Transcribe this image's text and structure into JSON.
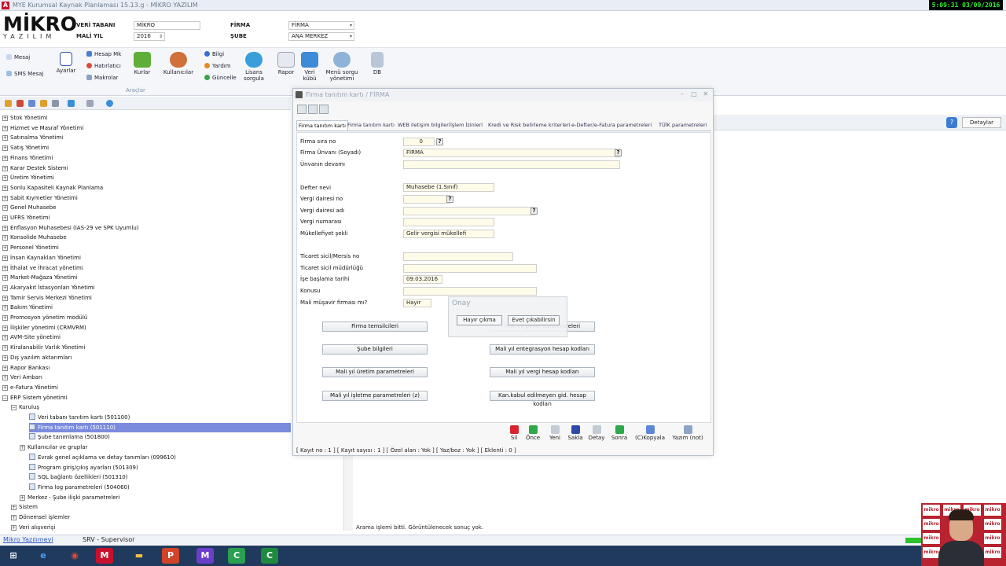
{
  "window": {
    "title": "MYE Kurumsal Kaynak Planlaması 15.13.g - MİKRO YAZILIM",
    "app_icon": "A",
    "clock": "5:09:31  03/09/2016"
  },
  "header": {
    "logo_main": "MİKRO",
    "logo_sub": "YAZILIM",
    "veri_tabani_label": "VERİ TABANI",
    "veri_tabani_value": "MİKRO",
    "mali_yil_label": "MALİ YIL",
    "mali_yil_value": "2016",
    "firma_label": "FİRMA",
    "firma_value": "FİRMA",
    "sube_label": "ŞUBE",
    "sube_value": "ANA MERKEZ"
  },
  "ribbon": {
    "mesaj": "Mesaj",
    "sms_mesaj": "SMS Mesaj",
    "ayarlar": "Ayarlar",
    "hesap_mk": "Hesap Mk",
    "hatirlatici": "Hatırlatıcı",
    "makrolar": "Makrolar",
    "kurlar": "Kurlar",
    "kullanicilar": "Kullanıcılar",
    "bilgi": "Bilgi",
    "yardim": "Yardım",
    "guncelle": "Güncelle",
    "lisans_sorgula": "Lisans sorgula",
    "rapor": "Rapor",
    "veri_kubu": "Veri kübü",
    "menu_sorgu_yonetimi": "Menü sorgu yönetimi",
    "db": "DB",
    "group_araclar": "Araçlar"
  },
  "tree": {
    "items": [
      {
        "label": "Stok Yönetimi",
        "level": 0,
        "expanded": false
      },
      {
        "label": "Hizmet ve Masraf Yönetimi",
        "level": 0,
        "expanded": false
      },
      {
        "label": "Satınalma Yönetimi",
        "level": 0,
        "expanded": false
      },
      {
        "label": "Satış Yönetimi",
        "level": 0,
        "expanded": false
      },
      {
        "label": "Finans Yönetimi",
        "level": 0,
        "expanded": false
      },
      {
        "label": "Karar Destek Sistemi",
        "level": 0,
        "expanded": false
      },
      {
        "label": "Üretim Yönetimi",
        "level": 0,
        "expanded": false
      },
      {
        "label": "Sonlu Kapasiteli Kaynak Planlama",
        "level": 0,
        "expanded": false
      },
      {
        "label": "Sabit Kıymetler Yönetimi",
        "level": 0,
        "expanded": false
      },
      {
        "label": "Genel Muhasebe",
        "level": 0,
        "expanded": false
      },
      {
        "label": "UFRS Yönetimi",
        "level": 0,
        "expanded": false
      },
      {
        "label": "Enflasyon Muhasebesi (IAS-29 ve SPK Uyumlu)",
        "level": 0,
        "expanded": false
      },
      {
        "label": "Konsolide Muhasebe",
        "level": 0,
        "expanded": false
      },
      {
        "label": "Personel Yönetimi",
        "level": 0,
        "expanded": false
      },
      {
        "label": "İnsan Kaynakları Yönetimi",
        "level": 0,
        "expanded": false
      },
      {
        "label": "İthalat ve İhracat yönetimi",
        "level": 0,
        "expanded": false
      },
      {
        "label": "Market-Mağaza Yönetimi",
        "level": 0,
        "expanded": false
      },
      {
        "label": "Akaryakıt İstasyonları Yönetimi",
        "level": 0,
        "expanded": false
      },
      {
        "label": "Tamir Servis Merkezi Yönetimi",
        "level": 0,
        "expanded": false
      },
      {
        "label": "Bakım Yönetimi",
        "level": 0,
        "expanded": false
      },
      {
        "label": "Promosyon yönetim modülü",
        "level": 0,
        "expanded": false
      },
      {
        "label": "İlişkiler yönetimi (CRMVRM)",
        "level": 0,
        "expanded": false
      },
      {
        "label": "AVM-Site yönetimi",
        "level": 0,
        "expanded": false
      },
      {
        "label": "Kiralanabilir Varlık Yönetimi",
        "level": 0,
        "expanded": false
      },
      {
        "label": "Dış yazılım aktarımları",
        "level": 0,
        "expanded": false
      },
      {
        "label": "Rapor Bankası",
        "level": 0,
        "expanded": false
      },
      {
        "label": "Veri Ambarı",
        "level": 0,
        "expanded": false
      },
      {
        "label": "e-Fatura Yönetimi",
        "level": 0,
        "expanded": false
      },
      {
        "label": "ERP Sistem yönetimi",
        "level": 0,
        "expanded": true
      },
      {
        "label": "Kuruluş",
        "level": 1,
        "expanded": true
      },
      {
        "label": "Veri tabanı tanıtım kartı (501100)",
        "level": 2,
        "leaf": true
      },
      {
        "label": "Firma tanıtım kartı (501110)",
        "level": 2,
        "leaf": true,
        "selected": true
      },
      {
        "label": "Şube tanımlama (501800)",
        "level": 2,
        "leaf": true
      },
      {
        "label": "Kullanıcılar ve gruplar",
        "level": 2,
        "expanded": false
      },
      {
        "label": "Evrak genel açıklama ve detay tanımları (099610)",
        "level": 2,
        "leaf": true
      },
      {
        "label": "Program giriş/çıkış ayarları (501309)",
        "level": 2,
        "leaf": true
      },
      {
        "label": "SQL bağlantı özellikleri (501310)",
        "level": 2,
        "leaf": true
      },
      {
        "label": "Firma log parametreleri (504060)",
        "level": 2,
        "leaf": true
      },
      {
        "label": "Merkez - Şube ilişki parametreleri",
        "level": 2,
        "expanded": false
      },
      {
        "label": "Sistem",
        "level": 1,
        "expanded": false
      },
      {
        "label": "Dönemsel işlemler",
        "level": 1,
        "expanded": false
      },
      {
        "label": "Veri alışverişi",
        "level": 1,
        "expanded": false
      }
    ]
  },
  "right_panel": {
    "detaylar": "Detaylar",
    "status": "Arama işlemi bitti. Görüntülenecek sonuç yok."
  },
  "bottom": {
    "link": "Mikro Yazılımevi",
    "srv": "SRV - Supervisor"
  },
  "dialog": {
    "title": "Firma tanıtım kartı / FİRMA",
    "tabs": [
      "Firma tanıtım kartı",
      "Firma tanıtım kartı",
      "WEB iletişim bilgileri",
      "İşlem İzinleri",
      "Kredi ve Risk belirleme kriterleri",
      "e-Defter/e-Fatura parametreleri",
      "TÜİK parametreleri"
    ],
    "fields": {
      "firma_sira_no_label": "Firma sıra no",
      "firma_sira_no_value": "0",
      "firma_unvani_label": "Firma Ünvanı (Soyadı)",
      "firma_unvani_value": "FİRMA",
      "unvan_devami_label": "Ünvanın devamı",
      "unvan_devami_value": "",
      "defter_nevi_label": "Defter nevi",
      "defter_nevi_value": "Muhasebe (1.Sınıf)",
      "vergi_dairesi_no_label": "Vergi dairesi no",
      "vergi_dairesi_no_value": "",
      "vergi_dairesi_adi_label": "Vergi dairesi adı",
      "vergi_dairesi_adi_value": "",
      "vergi_numarasi_label": "Vergi numarası",
      "vergi_numarasi_value": "",
      "mukellefiyet_label": "Mükellefiyet şekli",
      "mukellefiyet_value": "Gelir vergisi mükellefi",
      "ticaret_sicil_label": "Ticaret sicil/Mersis no",
      "ticaret_mudurlugu_label": "Ticaret sicil müdürlüğü",
      "ise_baslama_label": "İşe başlama tarihi",
      "ise_baslama_value": "09.03.2016",
      "konusu_label": "Konusu",
      "mali_musavir_label": "Mali müşavir firması mı?",
      "mali_musavir_value": "Hayır"
    },
    "buttons": {
      "firma_temsilcileri": "Firma temsilcileri",
      "sube_bilgileri": "Şube bilgileri",
      "mali_yil_uretim": "Mali yıl üretim parametreleri",
      "mali_yil_isletme": "Mali yıl işletme parametreleri (z)",
      "mali_yil_genel": "Mali yıl genel parametreleri",
      "mali_yil_entegrasyon": "Mali yıl entegrasyon hesap kodları",
      "mali_yil_vergi": "Mali yıl vergi hesap kodları",
      "kkeg": "Kan.kabul edilmeyen gid. hesap kodları"
    },
    "onay": {
      "title": "Onay",
      "hayir": "Hayır çıkma",
      "evet": "Evet çıkabilirsin"
    },
    "actions": [
      {
        "label": "Sil",
        "color": "#d9232e"
      },
      {
        "label": "Önce",
        "color": "#2fa84a"
      },
      {
        "label": "Yeni",
        "color": "#c5cbd3"
      },
      {
        "label": "Sakla",
        "color": "#2e4aa8"
      },
      {
        "label": "Detay",
        "color": "#c5cbd3"
      },
      {
        "label": "Sonra",
        "color": "#2fa84a"
      },
      {
        "label": "(C)Kopyala",
        "color": "#5d86d8"
      },
      {
        "label": "Yazım (not)",
        "color": "#8da3c8"
      }
    ],
    "status": "[ Kayıt no : 1 ] [ Kayıt sayısı : 1 ] [ Özel alan : Yok ] [ Yaz/boz : Yok ] [ Eklenti : 0 ]"
  },
  "webcam": {
    "tile_text": "mikro"
  }
}
